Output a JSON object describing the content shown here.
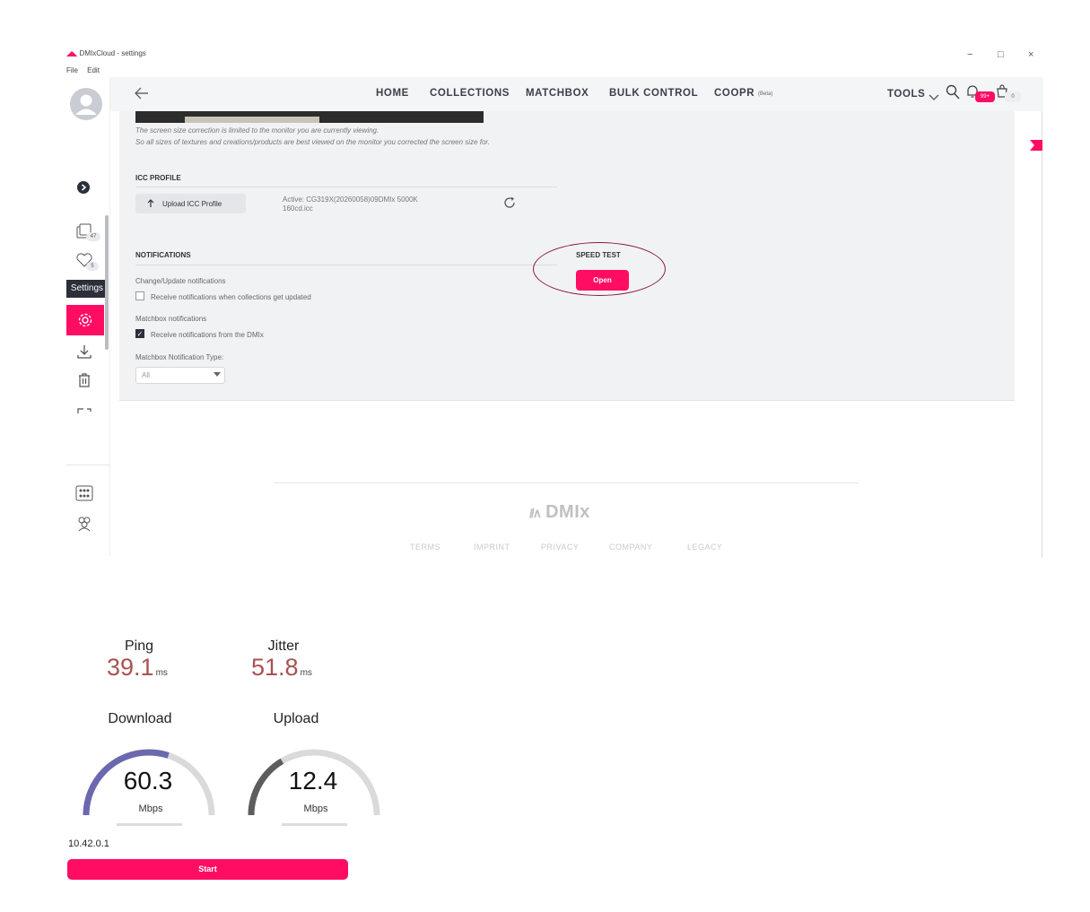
{
  "window": {
    "title": "DMIxCloud - settings",
    "menu": [
      "File",
      "Edit"
    ],
    "controls": [
      "−",
      "□",
      "×"
    ]
  },
  "sidebar": {
    "collections_count": "47",
    "favorites_count": "5",
    "tooltip": "Settings"
  },
  "nav": {
    "links": [
      "HOME",
      "COLLECTIONS",
      "MATCHBOX",
      "BULK CONTROL",
      "COOPR"
    ],
    "coopr_badge": "(Beta)",
    "tools": "TOOLS",
    "notif_badge": "99+",
    "cart_badge": "0"
  },
  "settings": {
    "screen_note_1": "The screen size correction is limited to the monitor you are currently viewing.",
    "screen_note_2": "So all sizes of textures and creations/products are best viewed on the monitor you corrected the screen size for.",
    "icc_label": "ICC PROFILE",
    "upload_icc": "Upload ICC Profile",
    "active_icc_1": "Active: CG319X(20260058)09DMIx 5000K",
    "active_icc_2": "160cd.icc",
    "notifications_label": "NOTIFICATIONS",
    "change_update": "Change/Update notifications",
    "collections_notif": "Receive notifications when collections get updated",
    "matchbox_notif_label": "Matchbox notifications",
    "dmix_notif": "Receive notifications from the DMIx",
    "type_label": "Matchbox Notification Type:",
    "type_value": "All",
    "speed_test_label": "SPEED TEST",
    "open_button": "Open"
  },
  "footer": {
    "logo": "DMIx",
    "links": [
      "TERMS",
      "IMPRINT",
      "PRIVACY",
      "COMPANY",
      "LEGACY"
    ]
  },
  "speedtest": {
    "ping_label": "Ping",
    "ping_value": "39.1",
    "ping_unit": "ms",
    "jitter_label": "Jitter",
    "jitter_value": "51.8",
    "jitter_unit": "ms",
    "download_label": "Download",
    "download_value": "60.3",
    "download_unit": "Mbps",
    "download_fraction": 0.6,
    "upload_label": "Upload",
    "upload_value": "12.4",
    "upload_unit": "Mbps",
    "upload_fraction": 0.33,
    "ip": "10.42.0.1",
    "start_button": "Start"
  },
  "colors": {
    "accent": "#ff0d62",
    "download_arc": "#6b68b0",
    "upload_arc": "#5d5d5d",
    "metric_value": "#a85252"
  }
}
